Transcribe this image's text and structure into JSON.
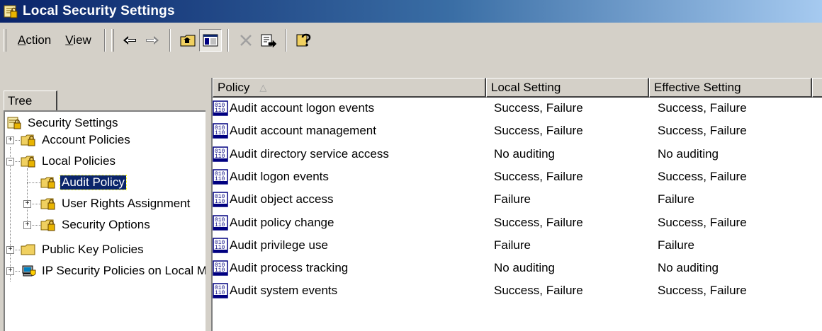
{
  "window": {
    "title": "Local Security Settings"
  },
  "menu": {
    "action": {
      "u": "A",
      "rest": "ction"
    },
    "view": {
      "u": "V",
      "rest": "iew"
    }
  },
  "toolbar": {
    "buttons": [
      {
        "name": "back-arrow-icon"
      },
      {
        "name": "forward-arrow-icon"
      },
      {
        "name": "up-folder-icon"
      },
      {
        "name": "show-hide-tree-icon"
      },
      {
        "name": "delete-icon"
      },
      {
        "name": "export-list-icon"
      },
      {
        "name": "help-icon"
      }
    ]
  },
  "tree": {
    "tab_label": "Tree",
    "nodes": [
      {
        "label": "Security Settings"
      },
      {
        "label": "Account Policies"
      },
      {
        "label": "Local Policies"
      },
      {
        "label": "Audit Policy"
      },
      {
        "label": "User Rights Assignment"
      },
      {
        "label": "Security Options"
      },
      {
        "label": "Public Key Policies"
      },
      {
        "label": "IP Security Policies on Local Machine"
      }
    ]
  },
  "list": {
    "columns": [
      "Policy",
      "Local Setting",
      "Effective Setting"
    ],
    "rows": [
      {
        "policy": "Audit account logon events",
        "local": "Success, Failure",
        "effective": "Success, Failure"
      },
      {
        "policy": "Audit account management",
        "local": "Success, Failure",
        "effective": "Success, Failure"
      },
      {
        "policy": "Audit directory service access",
        "local": "No auditing",
        "effective": "No auditing"
      },
      {
        "policy": "Audit logon events",
        "local": "Success, Failure",
        "effective": "Success, Failure"
      },
      {
        "policy": "Audit object access",
        "local": "Failure",
        "effective": "Failure"
      },
      {
        "policy": "Audit policy change",
        "local": "Success, Failure",
        "effective": "Success, Failure"
      },
      {
        "policy": "Audit privilege use",
        "local": "Failure",
        "effective": "Failure"
      },
      {
        "policy": "Audit process tracking",
        "local": "No auditing",
        "effective": "No auditing"
      },
      {
        "policy": "Audit system events",
        "local": "Success, Failure",
        "effective": "Success, Failure"
      }
    ]
  },
  "colors": {
    "titlebar_start": "#0a246a",
    "titlebar_end": "#a6caf0",
    "face": "#d4d0c8",
    "selection": "#0a246a"
  }
}
